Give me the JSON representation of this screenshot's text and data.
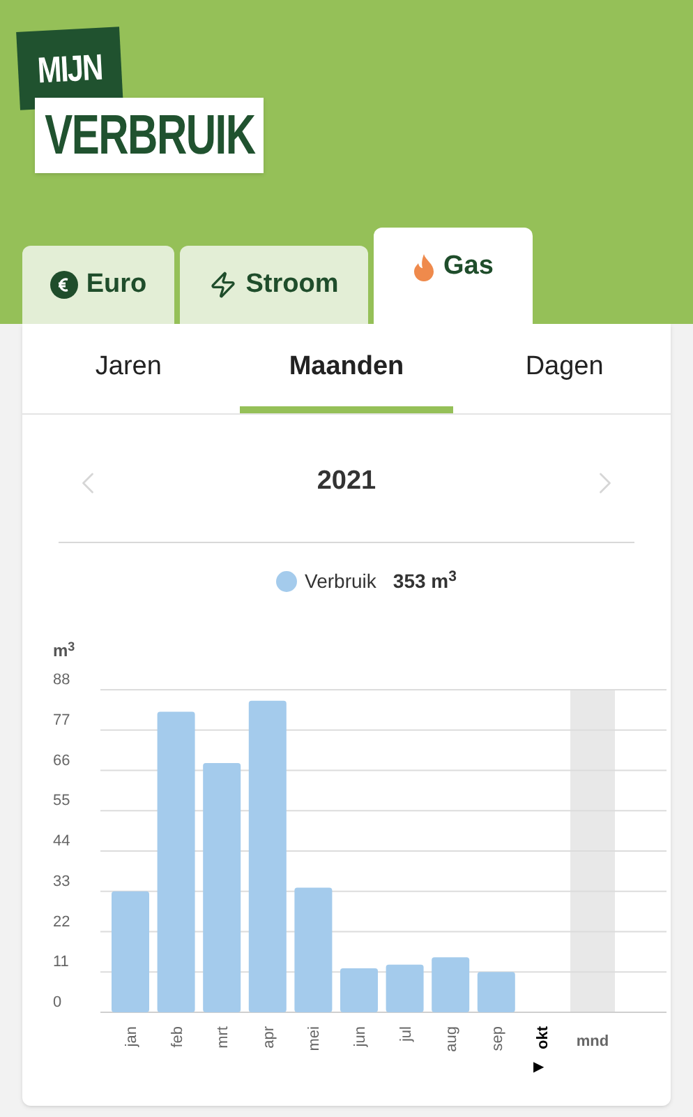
{
  "logo": {
    "line_1": "MIJN",
    "line_2": "VERBRUIK"
  },
  "energy_tabs": [
    {
      "label": "Euro",
      "kind": "euro",
      "selected": false
    },
    {
      "label": "Stroom",
      "kind": "power",
      "selected": false
    },
    {
      "label": "Gas",
      "kind": "gas",
      "selected": true
    }
  ],
  "period_tabs": [
    {
      "label": "Jaren",
      "selected": false
    },
    {
      "label": "Maanden",
      "selected": true
    },
    {
      "label": "Dagen",
      "selected": false
    }
  ],
  "year_nav": {
    "year": "2021"
  },
  "legend": {
    "total": "353 m$^{3}$"
  },
  "chart": {
    "current_marker": "▶",
    "chart_data": {
      "type": "bar",
      "ylabel": "m$^{3}$",
      "xlabel": "mnd",
      "categories": [
        "jan",
        "feb",
        "mrt",
        "apr",
        "mei",
        "jun",
        "jul",
        "aug",
        "sep",
        "okt"
      ],
      "series": [
        {
          "name": "Verbruik",
          "color": "#a4cbec",
          "values": [
            33,
            82,
            68,
            85,
            34,
            12,
            13,
            15,
            11,
            null
          ]
        }
      ],
      "ylim": [
        0,
        88
      ],
      "yticks": [
        0,
        11,
        22,
        33,
        44,
        55,
        66,
        77,
        88
      ],
      "grid": true
    }
  }
}
